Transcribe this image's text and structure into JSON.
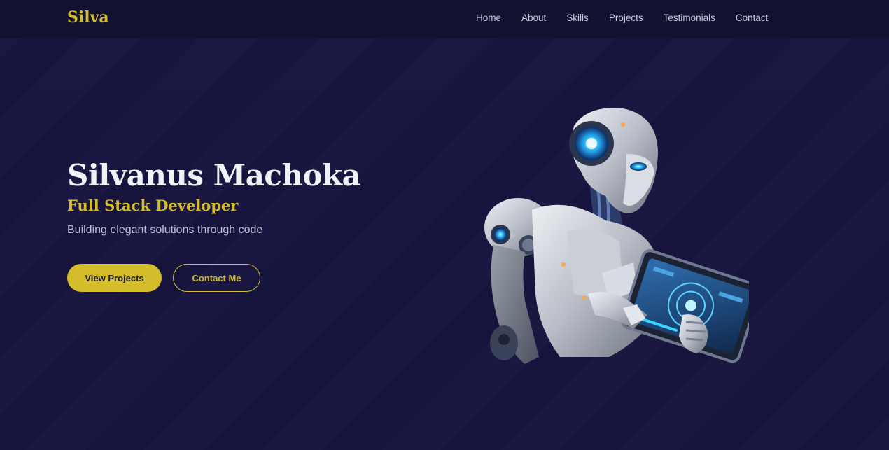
{
  "nav": {
    "brand": "Silva",
    "links": [
      "Home",
      "About",
      "Skills",
      "Projects",
      "Testimonials",
      "Contact"
    ]
  },
  "hero": {
    "name": "Silvanus Machoka",
    "role": "Full Stack Developer",
    "tagline": "Building elegant solutions through code",
    "primary_button": "View Projects",
    "secondary_button": "Contact Me",
    "image": "robot-with-tablet-illustration"
  },
  "colors": {
    "background": "#17153f",
    "navbar": "#12112f",
    "accent": "#d4bd2a",
    "heading": "#f1f1f8",
    "muted_text": "#bdbfd6"
  }
}
